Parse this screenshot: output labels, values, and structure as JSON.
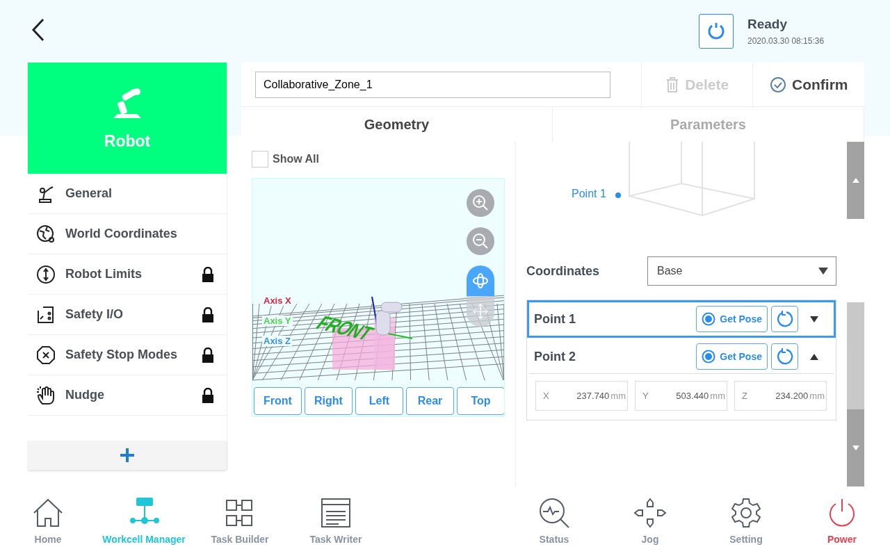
{
  "header": {
    "status": "Ready",
    "datetime": "2020.03.30 08:15:36"
  },
  "sidebar": {
    "title": "Robot",
    "items": [
      {
        "label": "General",
        "locked": false
      },
      {
        "label": "World Coordinates",
        "locked": false
      },
      {
        "label": "Robot Limits",
        "locked": true
      },
      {
        "label": "Safety I/O",
        "locked": true
      },
      {
        "label": "Safety Stop Modes",
        "locked": true
      },
      {
        "label": "Nudge",
        "locked": true
      }
    ]
  },
  "zone_name": "Collaborative_Zone_1",
  "actions": [
    {
      "label": "Delete",
      "disabled": true
    },
    {
      "label": "Confirm",
      "disabled": false
    }
  ],
  "tabs": [
    {
      "label": "Geometry",
      "selected": true
    },
    {
      "label": "Parameters",
      "selected": false
    }
  ],
  "show_all": {
    "label": "Show All",
    "checked": false
  },
  "viewer": {
    "axes": [
      {
        "label": "Axis X",
        "color": "#e0203c"
      },
      {
        "label": "Axis Y",
        "color": "#4cd44c"
      },
      {
        "label": "Axis Z",
        "color": "#3a8fe0"
      }
    ],
    "floor_label": "FRONT",
    "view_buttons": [
      "Front",
      "Right",
      "Left",
      "Rear",
      "Top"
    ]
  },
  "diagram_label": "Point 1",
  "coordinates": {
    "label": "Coordinates",
    "value": "Base"
  },
  "points": [
    {
      "name": "Point 1",
      "selected": true,
      "expanded": false,
      "action": "Get Pose"
    },
    {
      "name": "Point 2",
      "selected": false,
      "expanded": true,
      "action": "Get Pose",
      "fields": [
        {
          "axis": "X",
          "value": "237.740",
          "unit": "mm"
        },
        {
          "axis": "Y",
          "value": "503.440",
          "unit": "mm"
        },
        {
          "axis": "Z",
          "value": "234.200",
          "unit": "mm"
        }
      ]
    }
  ],
  "nav": [
    {
      "label": "Home",
      "selected": false,
      "kind": "normal"
    },
    {
      "label": "Workcell Manager",
      "selected": true,
      "kind": "normal"
    },
    {
      "label": "Task Builder",
      "selected": false,
      "kind": "normal"
    },
    {
      "label": "Task Writer",
      "selected": false,
      "kind": "normal"
    },
    {
      "label": "Status",
      "selected": false,
      "kind": "normal"
    },
    {
      "label": "Jog",
      "selected": false,
      "kind": "normal"
    },
    {
      "label": "Setting",
      "selected": false,
      "kind": "normal"
    },
    {
      "label": "Power",
      "selected": false,
      "kind": "power"
    }
  ]
}
